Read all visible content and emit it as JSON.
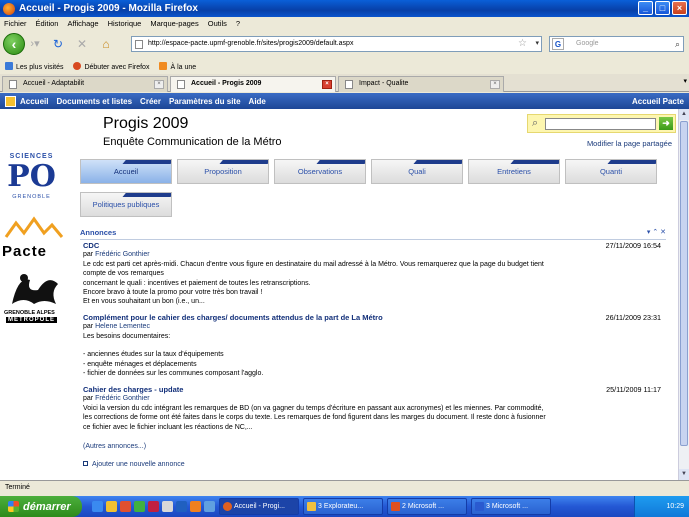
{
  "window": {
    "title": "Accueil - Progis 2009 - Mozilla Firefox"
  },
  "menu": [
    "Fichier",
    "Édition",
    "Affichage",
    "Historique",
    "Marque-pages",
    "Outils",
    "?"
  ],
  "url": "http://espace-pacte.upmf-grenoble.fr/sites/progis2009/default.aspx",
  "search_engine_placeholder": "Google",
  "bookmarks": [
    "Les plus visités",
    "Débuter avec Firefox",
    "À la une"
  ],
  "tabs": [
    {
      "label": "Accueil - Adaptabilit",
      "active": false
    },
    {
      "label": "Accueil - Progis 2009",
      "active": true
    },
    {
      "label": "Impact - Qualite",
      "active": false
    }
  ],
  "sp_top": {
    "items": [
      "Accueil",
      "Documents et listes",
      "Créer",
      "Paramètres du site",
      "Aide"
    ],
    "right": "Accueil Pacte"
  },
  "site": {
    "title": "Progis 2009",
    "subtitle": "Enquête Communication de la Métro",
    "modify_link": "Modifier la page partagée"
  },
  "logos": {
    "sciencespo_top": "SCIENCES",
    "sciencespo_mid": "PO",
    "sciencespo_bottom": "GRENOBLE",
    "pacte": "Pacte",
    "metro_line1": "GRENOBLE ALPES",
    "metro_line2": "MÉTROPOLE"
  },
  "nav_tabs": [
    "Accueil",
    "Proposition",
    "Observations",
    "Quali",
    "Entretiens",
    "Quanti",
    "Politiques publiques"
  ],
  "announcements": {
    "header": "Annonces",
    "items": [
      {
        "title": "CDC",
        "date": "27/11/2009 16:54",
        "by_prefix": "par",
        "author": "Frédéric Gonthier",
        "body": [
          "Le cdc est parti cet après-midi. Chacun d'entre vous figure en destinataire du mail adressé à la Métro. Vous remarquerez que la page du budget tient",
          "compte de vos remarques",
          "concernant le quali : incentives et paiement de toutes les retranscriptions.",
          "Encore bravo à toute la promo pour votre très bon travail !",
          "Et en vous souhaitant un bon (i.e., un..."
        ]
      },
      {
        "title": "Complément pour le cahier des charges/ documents attendus de la part de La Métro",
        "date": "26/11/2009 23:31",
        "by_prefix": "par",
        "author": "Helene Lementec",
        "body": [
          "Les besoins documentaires:",
          "",
          "- anciennes études sur la taux d'équipements",
          "- enquête ménages et déplacements",
          "- fichier de données sur les communes composant l'agglo."
        ]
      },
      {
        "title": "Cahier des charges - update",
        "date": "25/11/2009 11:17",
        "by_prefix": "par",
        "author": "Frédéric Gonthier",
        "body": [
          "Voici la version du cdc intégrant les remarques de BD (on va gagner du temps d'écriture en passant aux acronymes) et les miennes. Par commodité,",
          "les corrections de forme ont été faites dans le corps du texte. Les remarques de fond figurent dans les marges du document. Il reste donc à fusionner",
          "ce fichier avec le fichier incluant les réactions de NC,..."
        ]
      }
    ],
    "more": "(Autres annonces...)",
    "add": "Ajouter une nouvelle annonce"
  },
  "status": "Terminé",
  "taskbar": {
    "start": "démarrer",
    "buttons": [
      "Accueil - Progi...",
      "3 Explorateu...",
      "2 Microsoft ...",
      "3 Microsoft ..."
    ],
    "clock": "10:29"
  }
}
